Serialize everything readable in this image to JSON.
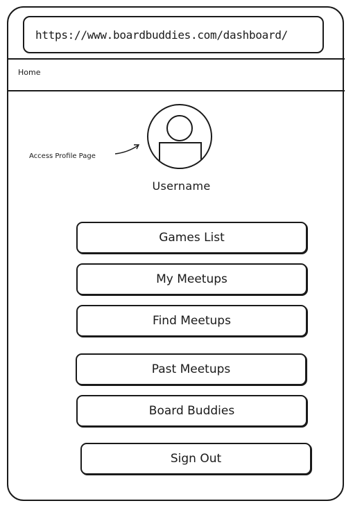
{
  "browser": {
    "url": "https://www.boardbuddies.com/dashboard/"
  },
  "breadcrumb": {
    "home_label": "Home"
  },
  "profile": {
    "annotation": "Access Profile Page",
    "username": "Username",
    "avatar_icon": "user-avatar-icon"
  },
  "menu": {
    "games_list": "Games List",
    "my_meetups": "My Meetups",
    "find_meetups": "Find Meetups",
    "past_meetups": "Past Meetups",
    "board_buddies": "Board Buddies",
    "sign_out": "Sign Out"
  },
  "colors": {
    "ink": "#1a1a1a",
    "background": "#ffffff"
  }
}
